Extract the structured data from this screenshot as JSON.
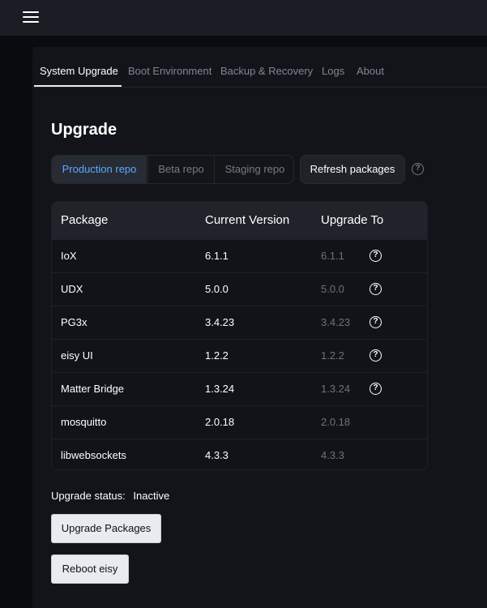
{
  "header": {
    "menu_icon": "hamburger-menu-icon"
  },
  "tabs": [
    {
      "label": "System Upgrade",
      "active": true
    },
    {
      "label": "Boot Environment",
      "active": false
    },
    {
      "label": "Backup & Recovery",
      "active": false
    },
    {
      "label": "Logs",
      "active": false
    },
    {
      "label": "About",
      "active": false
    }
  ],
  "page": {
    "title": "Upgrade"
  },
  "repos": {
    "selected": "Production repo",
    "options": [
      "Production repo",
      "Beta repo",
      "Staging repo"
    ]
  },
  "toolbar": {
    "refresh_label": "Refresh packages",
    "help_icon": "help-circle-icon"
  },
  "table": {
    "headers": [
      "Package",
      "Current Version",
      "Upgrade To"
    ],
    "rows": [
      {
        "package": "IoX",
        "current": "6.1.1",
        "upgrade": "6.1.1",
        "info": true
      },
      {
        "package": "UDX",
        "current": "5.0.0",
        "upgrade": "5.0.0",
        "info": true
      },
      {
        "package": "PG3x",
        "current": "3.4.23",
        "upgrade": "3.4.23",
        "info": true
      },
      {
        "package": "eisy UI",
        "current": "1.2.2",
        "upgrade": "1.2.2",
        "info": true
      },
      {
        "package": "Matter Bridge",
        "current": "1.3.24",
        "upgrade": "1.3.24",
        "info": true
      },
      {
        "package": "mosquitto",
        "current": "2.0.18",
        "upgrade": "2.0.18",
        "info": false
      },
      {
        "package": "libwebsockets",
        "current": "4.3.3",
        "upgrade": "4.3.3",
        "info": false
      }
    ]
  },
  "status": {
    "label": "Upgrade status:",
    "value": "Inactive"
  },
  "actions": {
    "upgrade_label": "Upgrade Packages",
    "reboot_label": "Reboot eisy"
  },
  "colors": {
    "accent": "#5fa8ff",
    "muted": "#6a7382",
    "background": "#0a0b0e"
  }
}
